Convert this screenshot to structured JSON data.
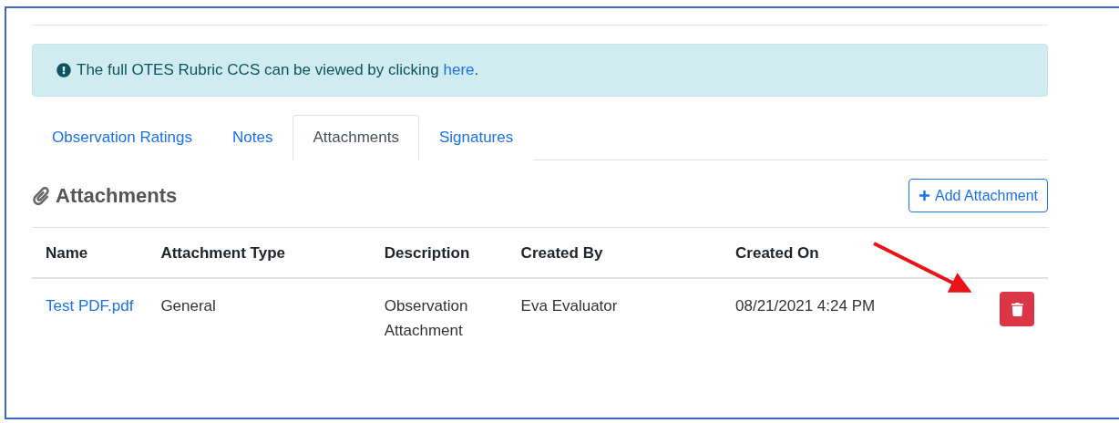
{
  "alert": {
    "text": "The full OTES Rubric CCS can be viewed by clicking ",
    "link": "here",
    "suffix": "."
  },
  "tabs": [
    {
      "label": "Observation Ratings",
      "selected": false
    },
    {
      "label": "Notes",
      "selected": false
    },
    {
      "label": "Attachments",
      "selected": true
    },
    {
      "label": "Signatures",
      "selected": false
    }
  ],
  "section": {
    "title": "Attachments",
    "add_button": "Add Attachment"
  },
  "table": {
    "columns": [
      "Name",
      "Attachment Type",
      "Description",
      "Created By",
      "Created On"
    ],
    "rows": [
      {
        "name": "Test PDF.pdf",
        "attachment_type": "General",
        "description": "Observation Attachment",
        "created_by": "Eva Evaluator",
        "created_on": "08/21/2021 4:24 PM"
      }
    ]
  },
  "annotation": {
    "kind": "arrow"
  }
}
